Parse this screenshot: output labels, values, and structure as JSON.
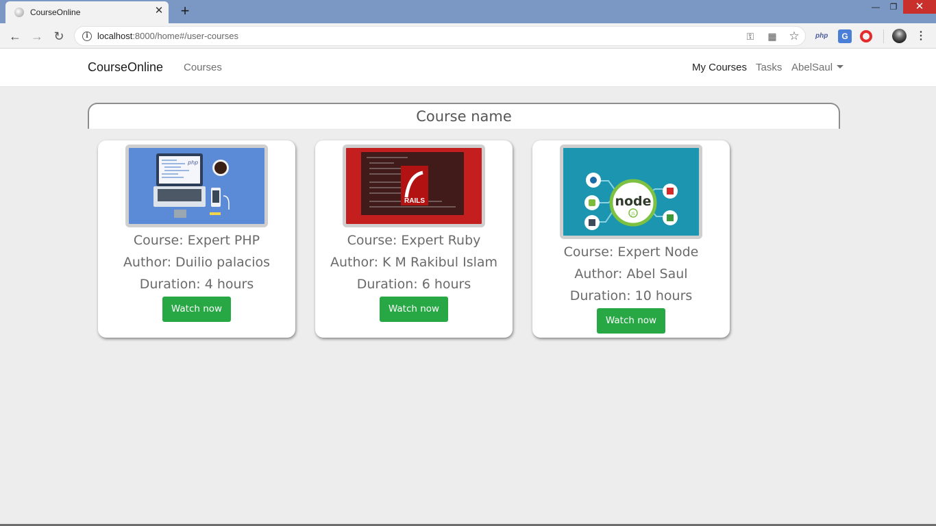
{
  "browser": {
    "tab_title": "CourseOnline",
    "tab_close": "✕",
    "new_tab": "+",
    "url_host": "localhost",
    "url_rest": ":8000/home#/user-courses",
    "window_controls": {
      "minimize": "—",
      "maximize": "❐",
      "close": "✕"
    },
    "icons": [
      "back-arrow-icon",
      "forward-arrow-icon",
      "reload-icon",
      "info-icon",
      "key-icon",
      "translate-icon",
      "star-icon",
      "php-extension-icon",
      "google-translate-icon",
      "opera-icon",
      "profile-avatar",
      "menu-dots-icon"
    ],
    "ext_php_label": "php",
    "ext_translate_label": "G"
  },
  "navbar": {
    "brand": "CourseOnline",
    "courses": "Courses",
    "my_courses": "My Courses",
    "tasks": "Tasks",
    "user": "AbelSaul"
  },
  "search": {
    "placeholder": "Course name",
    "value": ""
  },
  "courses": [
    {
      "course": "Course: Expert PHP",
      "author": "Author: Duilio palacios",
      "duration": "Duration: 4 hours",
      "button": "Watch now",
      "thumb_color": "#5b8ad6"
    },
    {
      "course": "Course: Expert Ruby",
      "author": "Author: K M Rakibul Islam",
      "duration": "Duration: 6 hours",
      "button": "Watch now",
      "thumb_color": "#c41e1e"
    },
    {
      "course": "Course: Expert Node",
      "author": "Author: Abel Saul",
      "duration": "Duration: 10 hours",
      "button": "Watch now",
      "thumb_color": "#1b95b0"
    }
  ],
  "thumb_text": {
    "php_logo": "php",
    "rails_logo": "RAILS",
    "node_logo": "node",
    "node_js": "JS"
  }
}
